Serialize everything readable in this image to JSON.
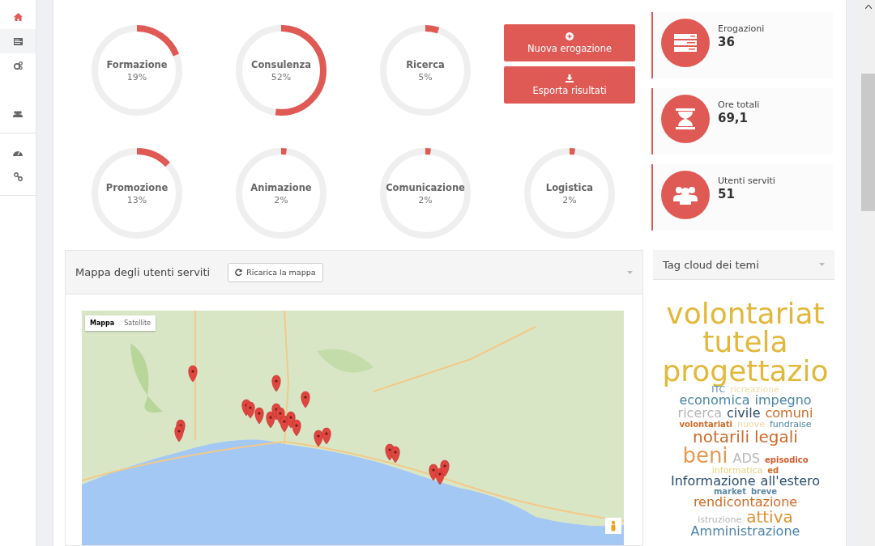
{
  "sidebar": {
    "groups": [
      [
        {
          "kind": "home",
          "selected": false
        },
        {
          "kind": "list",
          "selected": true
        },
        {
          "kind": "cogs",
          "selected": false
        },
        {
          "kind": "users",
          "selected": false
        }
      ],
      [
        {
          "kind": "gauge",
          "selected": false
        },
        {
          "kind": "link",
          "selected": false
        }
      ]
    ]
  },
  "donuts": [
    {
      "label": "Formazione",
      "percent": "19%",
      "level": 0.19
    },
    {
      "label": "Consulenza",
      "percent": "52%",
      "level": 0.52
    },
    {
      "label": "Ricerca",
      "percent": "5%",
      "level": 0.05
    },
    {
      "label": "Promozione",
      "percent": "13%",
      "level": 0.13
    },
    {
      "label": "Animazione",
      "percent": "2%",
      "level": 0.02
    },
    {
      "label": "Comunicazione",
      "percent": "2%",
      "level": 0.02
    },
    {
      "label": "Logistica",
      "percent": "2%",
      "level": 0.02
    }
  ],
  "actions": [
    {
      "kind": "add",
      "label": "Nuova erogazione"
    },
    {
      "kind": "download",
      "label": "Esporta risultati"
    }
  ],
  "stats": [
    {
      "kind": "list",
      "label": "Erogazioni",
      "value": "36"
    },
    {
      "kind": "hourglass",
      "label": "Ore totali",
      "value": "69,1"
    },
    {
      "kind": "users",
      "label": "Utenti serviti",
      "value": "51"
    }
  ],
  "map_panel": {
    "title": "Mappa degli utenti serviti",
    "reload_button": "Ricarica la mappa",
    "map_types": [
      {
        "label": "Mappa",
        "selected": true
      },
      {
        "label": "Satellite",
        "selected": false
      }
    ]
  },
  "tag_cloud": {
    "title": "Tag cloud dei temi",
    "rows": [
      [
        {
          "text": "volontariat",
          "kind": "huge",
          "color": "#e2b83a"
        }
      ],
      [
        {
          "text": "tutela",
          "kind": "huge",
          "color": "#e2b83a"
        }
      ],
      [
        {
          "text": "progettazio",
          "kind": "huge",
          "color": "#e2b83a"
        }
      ],
      [
        {
          "text": "ITC",
          "kind": "small",
          "color": "#5d88a8"
        },
        {
          "text": "ricreazione",
          "kind": "small",
          "color": "#f0dca8"
        }
      ],
      [
        {
          "text": "economica",
          "kind": "medium",
          "color": "#4c84a6"
        },
        {
          "text": "impegno",
          "kind": "medium",
          "color": "#4c84a6"
        }
      ],
      [
        {
          "text": "ricerca",
          "kind": "medium",
          "color": "#b5b5b5"
        },
        {
          "text": "civile",
          "kind": "medium",
          "color": "#2c4d6d"
        },
        {
          "text": "comuni",
          "kind": "medium",
          "color": "#d06a25"
        }
      ],
      [
        {
          "text": "volontariati",
          "kind": "tiny",
          "color": "#d26a2a"
        },
        {
          "text": "nuove",
          "kind": "small",
          "color": "#eed79c"
        },
        {
          "text": "fundraise",
          "kind": "small",
          "color": "#4c84a6"
        }
      ],
      [
        {
          "text": "notarili",
          "kind": "large",
          "color": "#cf6a2a"
        },
        {
          "text": "legali",
          "kind": "large",
          "color": "#cf6a2a"
        }
      ],
      [
        {
          "text": "beni",
          "kind": "big",
          "color": "#e59a50"
        },
        {
          "text": "ADS",
          "kind": "medium",
          "color": "#b8b8b8"
        },
        {
          "text": "episodico",
          "kind": "tiny",
          "color": "#d45a2a"
        }
      ],
      [
        {
          "text": "informatica",
          "kind": "small",
          "color": "#ebcf80"
        },
        {
          "text": "ed",
          "kind": "tiny",
          "color": "#d06a25"
        }
      ],
      [
        {
          "text": "Informazione",
          "kind": "medium",
          "color": "#2c4d6d"
        },
        {
          "text": "all'estero",
          "kind": "medium",
          "color": "#2c4d6d"
        }
      ],
      [
        {
          "text": "market",
          "kind": "tiny",
          "color": "#5d88a8"
        },
        {
          "text": "breve",
          "kind": "tiny",
          "color": "#5d88a8"
        }
      ],
      [
        {
          "text": "rendicontazione",
          "kind": "medium",
          "color": "#d06a25"
        }
      ],
      [
        {
          "text": "istruzione",
          "kind": "small",
          "color": "#b5b5b5"
        },
        {
          "text": "attiva",
          "kind": "large",
          "color": "#e0902e"
        }
      ],
      [
        {
          "text": "Amministrazione",
          "kind": "medium",
          "color": "#4c84a6"
        }
      ]
    ]
  }
}
